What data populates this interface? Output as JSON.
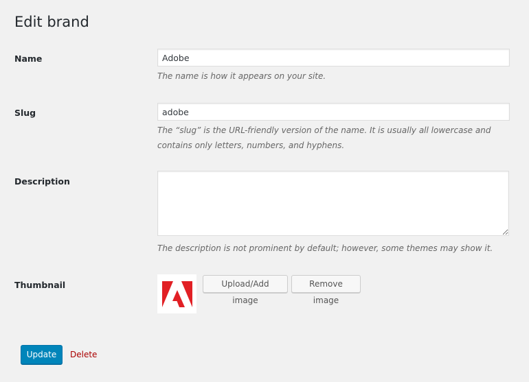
{
  "page": {
    "title": "Edit brand"
  },
  "fields": {
    "name": {
      "label": "Name",
      "value": "Adobe",
      "description": "The name is how it appears on your site."
    },
    "slug": {
      "label": "Slug",
      "value": "adobe",
      "description": "The “slug” is the URL-friendly version of the name. It is usually all lowercase and contains only letters, numbers, and hyphens."
    },
    "description": {
      "label": "Description",
      "value": "",
      "description": "The description is not prominent by default; however, some themes may show it."
    },
    "thumbnail": {
      "label": "Thumbnail",
      "image_icon": "adobe-logo-icon",
      "upload_label": "Upload/Add image",
      "remove_label": "Remove image"
    }
  },
  "actions": {
    "update_label": "Update",
    "delete_label": "Delete"
  },
  "colors": {
    "primary": "#0085ba",
    "delete": "#aa0000",
    "adobe_red": "#e12025"
  }
}
